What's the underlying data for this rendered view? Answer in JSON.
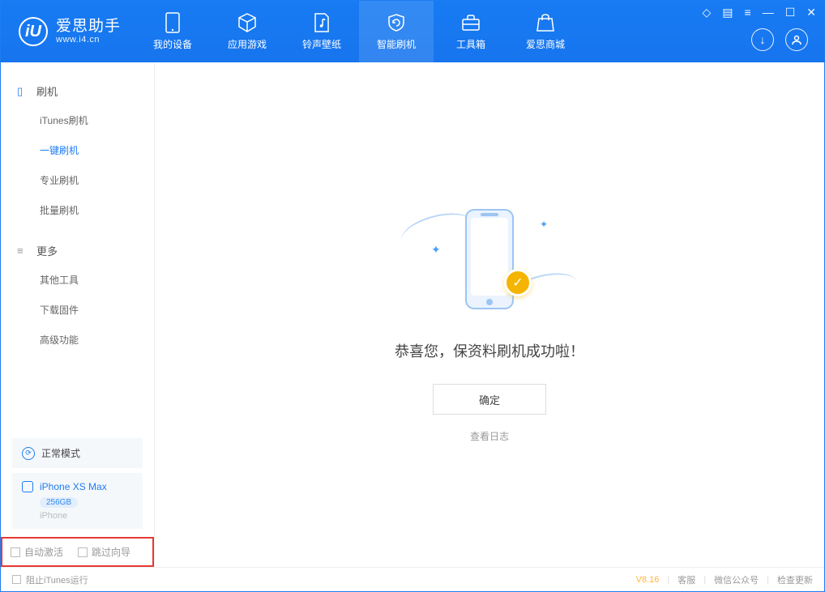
{
  "brand": {
    "name": "爱思助手",
    "site": "www.i4.cn"
  },
  "nav": {
    "items": [
      {
        "label": "我的设备"
      },
      {
        "label": "应用游戏"
      },
      {
        "label": "铃声壁纸"
      },
      {
        "label": "智能刷机"
      },
      {
        "label": "工具箱"
      },
      {
        "label": "爱思商城"
      }
    ]
  },
  "sidebar": {
    "groups": [
      {
        "title": "刷机",
        "items": [
          "iTunes刷机",
          "一键刷机",
          "专业刷机",
          "批量刷机"
        ]
      },
      {
        "title": "更多",
        "items": [
          "其他工具",
          "下载固件",
          "高级功能"
        ]
      }
    ],
    "mode": "正常模式",
    "device": {
      "name": "iPhone XS Max",
      "storage": "256GB",
      "type": "iPhone"
    },
    "options": {
      "auto_activate": "自动激活",
      "skip_guide": "跳过向导"
    }
  },
  "main": {
    "success_msg": "恭喜您，保资料刷机成功啦！",
    "ok_button": "确定",
    "view_log": "查看日志"
  },
  "footer": {
    "block_itunes": "阻止iTunes运行",
    "version": "V8.16",
    "links": [
      "客服",
      "微信公众号",
      "检查更新"
    ]
  }
}
